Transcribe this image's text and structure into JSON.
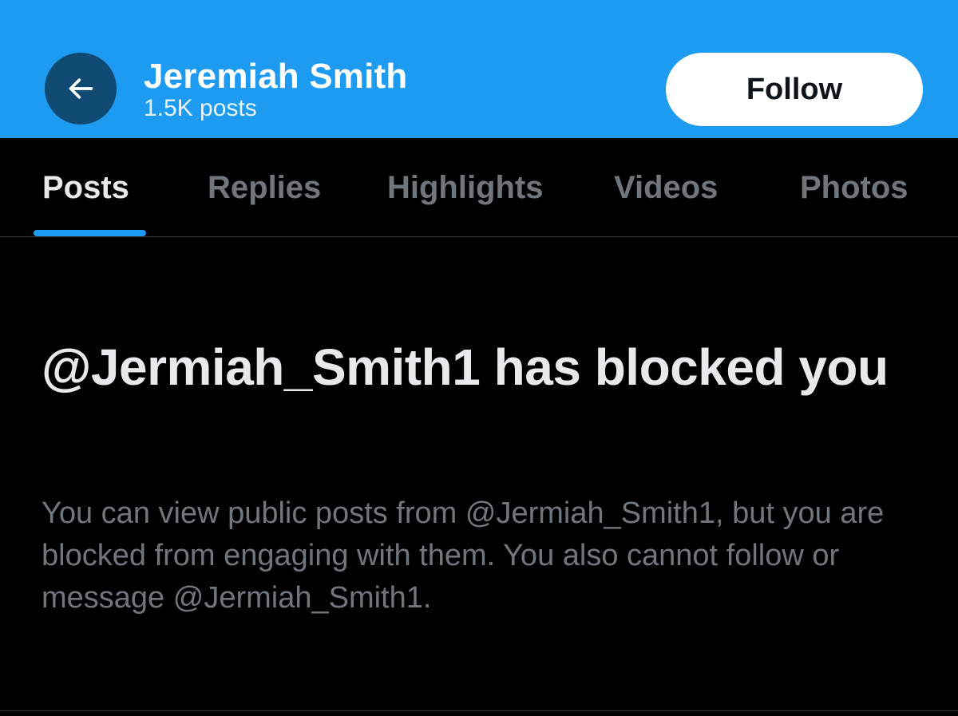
{
  "header": {
    "back_icon": "arrow-left-icon",
    "name": "Jeremiah Smith",
    "posts_count": "1.5K posts",
    "follow_label": "Follow"
  },
  "tabs": [
    {
      "label": "Posts",
      "active": true
    },
    {
      "label": "Replies",
      "active": false
    },
    {
      "label": "Highlights",
      "active": false
    },
    {
      "label": "Videos",
      "active": false
    },
    {
      "label": "Photos",
      "active": false
    }
  ],
  "blocked": {
    "title": "@Jermiah_Smith1 has blocked you",
    "description": "You can view public posts from @Jermiah_Smith1, but you are blocked from engaging with them. You also cannot follow or message @Jermiah_Smith1."
  },
  "colors": {
    "header_bg": "#1d9bf0",
    "back_button_bg": "#0f4a73",
    "accent": "#1d9bf0",
    "background": "#000000",
    "text_primary": "#e7e9ea",
    "text_secondary": "#71767b"
  }
}
